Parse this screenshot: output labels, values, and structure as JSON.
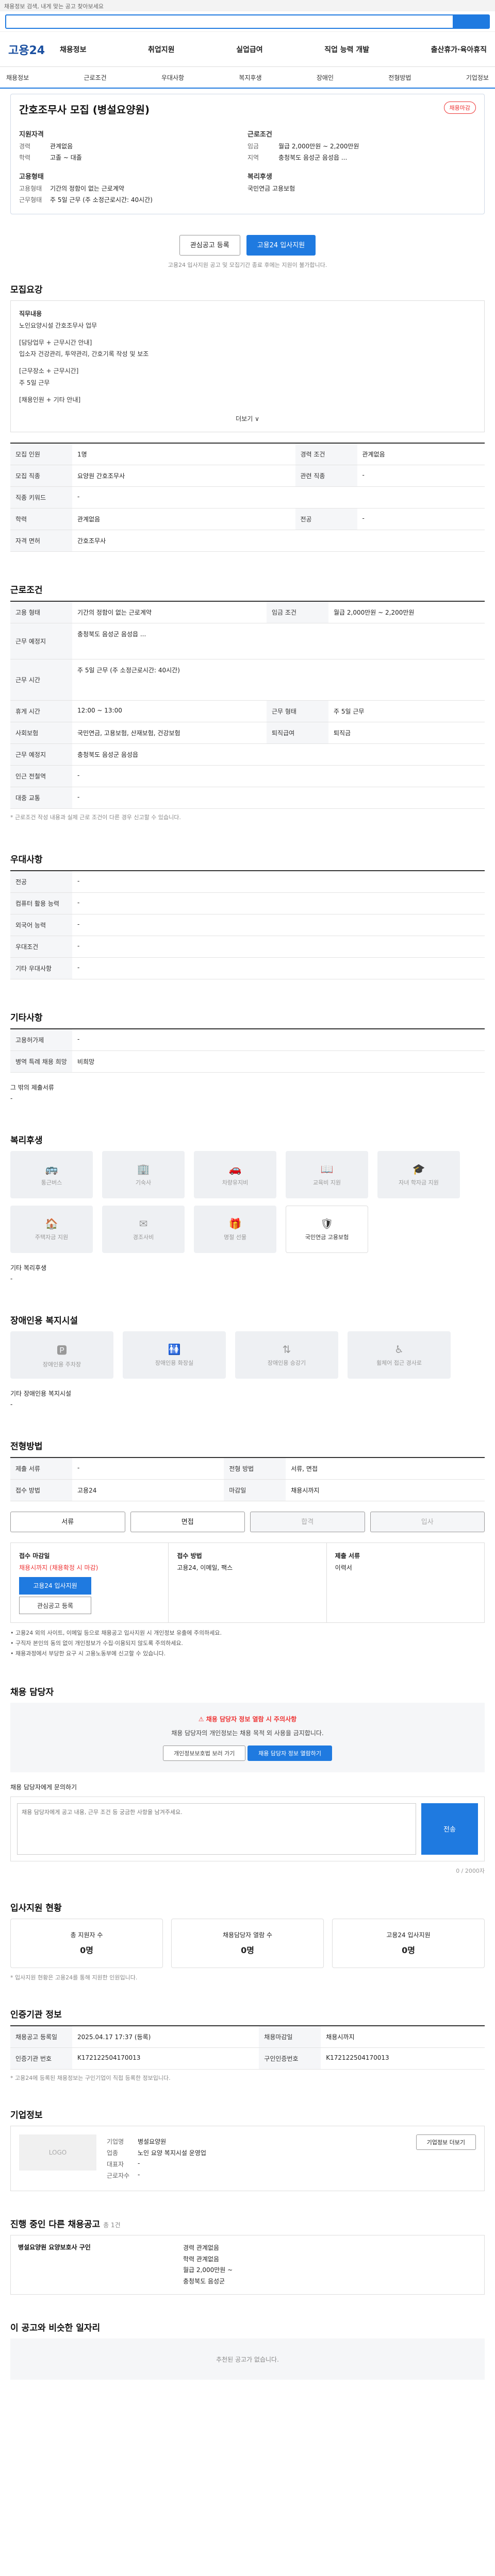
{
  "header": {
    "note": "채용정보 검색, 내게 맞는 공고 찾아보세요",
    "logo": "고용24",
    "menu": [
      "채용정보",
      "취업지원",
      "실업급여",
      "직업 능력 개발",
      "출산휴가·육아휴직"
    ],
    "subnav": [
      "채용정보",
      "근로조건",
      "우대사항",
      "복지후생",
      "장애인",
      "전형방법",
      "기업정보"
    ]
  },
  "job": {
    "title": "간호조무사 모집 (병설요양원)",
    "badge": "채용마감",
    "left_title": "지원자격",
    "right_title": "근로조건",
    "left_rows": [
      {
        "k": "경력",
        "v": "관계없음"
      },
      {
        "k": "학력",
        "v": "고졸 ~ 대졸"
      }
    ],
    "right_rows": [
      {
        "k": "임금",
        "v": "월급 2,000만원 ~ 2,200만원"
      },
      {
        "k": "지역",
        "v": "충청북도 음성군 음성읍 ..."
      }
    ],
    "left_rows2_title": "고용형태",
    "left_rows2": [
      {
        "k": "고용형태",
        "v": "기간의 정함이 없는 근로계약"
      },
      {
        "k": "근무형태",
        "v": "주 5일 근무 (주 소정근로시간: 40시간)"
      }
    ],
    "right_rows2_title": "복리후생",
    "right_rows2": [
      {
        "k": "",
        "v": "국민연금 고용보험"
      }
    ],
    "btn_save": "관심공고 등록",
    "btn_apply": "고용24 입사지원",
    "apply_note": "고용24 입사지원 공고 및 모집기간 종료 후에는 지원이 불가합니다."
  },
  "sections": {
    "recruit": "모집요강",
    "cond": "근로조건",
    "pref": "우대사항",
    "other": "기타사항",
    "welfare": "복리후생",
    "disabled": "장애인용 복지시설",
    "process": "전형방법",
    "manager": "채용 담당자",
    "history": "입사지원 현황",
    "info": "인증기관 정보",
    "company": "기업정보",
    "similar": "진행 중인 다른 채용공고",
    "ai": "이 공고와 비슷한 일자리"
  },
  "recruit": {
    "label": "직무내용",
    "lines": [
      "노인요양시설 간호조무사 업무",
      "[담당업무 + 근무시간 안내]",
      "입소자 건강관리, 투약관리, 간호기록 작성 및 보조",
      "[근무장소 + 근무시간]",
      "주 5일 근무",
      "[채용인원 + 기타 안내]"
    ],
    "more": "더보기 ∨",
    "table": [
      {
        "k": "모집 인원",
        "v": "1명",
        "k2": "경력 조건",
        "v2": "관계없음"
      },
      {
        "k": "모집 직종",
        "v": "요양원 간호조무사",
        "k2": "관련 직종",
        "v2": "-"
      },
      {
        "k": "직종 키워드",
        "v": "-",
        "k2": "",
        "v2": ""
      },
      {
        "k": "학력",
        "v": "관계없음",
        "k2": "전공",
        "v2": "-"
      },
      {
        "k": "자격 면허",
        "v": "간호조무사",
        "k2": "",
        "v2": ""
      }
    ]
  },
  "cond": {
    "rows": [
      {
        "k": "고용 형태",
        "v": "기간의 정함이 없는 근로계약",
        "k2": "임금 조건",
        "v2": "월급 2,000만원 ~ 2,200만원"
      },
      {
        "k": "근무 예정지",
        "v": "충청북도 음성군 음성읍 ...",
        "k2": "",
        "v2": ""
      },
      {
        "k": "근무 시간",
        "v": "주 5일 근무 (주 소정근로시간: 40시간)",
        "k2": "",
        "v2": ""
      },
      {
        "k": "휴게 시간",
        "v": "12:00 ~ 13:00",
        "k2": "근무 형태",
        "v2": "주 5일 근무"
      },
      {
        "k": "사회보험",
        "v": "국민연금, 고용보험, 산재보험, 건강보험",
        "k2": "퇴직급여",
        "v2": "퇴직금"
      },
      {
        "k": "근무 예정지",
        "v": "충청북도 음성군 음성읍",
        "k2": "",
        "v2": ""
      },
      {
        "k": "인근 전철역",
        "v": "-",
        "k2": "",
        "v2": ""
      },
      {
        "k": "대중 교통",
        "v": "-",
        "k2": "",
        "v2": ""
      }
    ],
    "note": "* 근로조건 작성 내용과 실제 근로 조건이 다른 경우 신고할 수 있습니다."
  },
  "pref": {
    "rows": [
      {
        "k": "전공",
        "v": "-"
      },
      {
        "k": "컴퓨터 활용 능력",
        "v": "-"
      },
      {
        "k": "외국어 능력",
        "v": "-"
      },
      {
        "k": "우대조건",
        "v": "-"
      },
      {
        "k": "기타 우대사항",
        "v": "-"
      }
    ]
  },
  "other": {
    "rows": [
      {
        "k": "고용허가제",
        "v": "-"
      },
      {
        "k": "병역 특례 채용 희망",
        "v": "비희망"
      }
    ],
    "extra_label": "그 밖의 제출서류",
    "extra_value": "-"
  },
  "welfare": {
    "items": [
      "통근버스",
      "기숙사",
      "차량유지비",
      "교육비 지원",
      "자녀 학자금 지원",
      "주택자금 지원",
      "경조사비",
      "명절 선물",
      "국민연금 고용보험"
    ],
    "extra_label": "기타 복리후생",
    "extra_value": "-"
  },
  "disabled": {
    "items": [
      "장애인용 주차장",
      "장애인용 화장실",
      "장애인용 승강기",
      "휠체어 접근 경사로"
    ],
    "extra_label": "기타 장애인용 복지시설",
    "extra_value": "-"
  },
  "process": {
    "rows": [
      {
        "k": "제출 서류",
        "v": "-"
      },
      {
        "k": "전형 방법",
        "v": "서류, 면접"
      },
      {
        "k": "접수 방법",
        "v": "고용24"
      },
      {
        "k": "마감일",
        "v": "채용시까지"
      }
    ],
    "steps": [
      "서류",
      "면접",
      "합격",
      "입사"
    ]
  },
  "apply": {
    "c1_title": "접수 마감일",
    "c1_value": "채용시까지 (채용확정 시 마감)",
    "c1_btn": "고용24 입사지원",
    "c1_btn2": "관심공고 등록",
    "c2_title": "접수 방법",
    "c2_value": "고용24, 이메일, 팩스",
    "c3_title": "제출 서류",
    "c3_value": "이력서"
  },
  "warn": [
    "• 고용24 외의 사이트, 이메일 등으로 채용공고 입사지원 시 개인정보 유출에 주의하세요.",
    "• 구직자 본인의 동의 없이 개인정보가 수집·이용되지 않도록 주의하세요.",
    "• 채용과정에서 부당한 요구 시 고용노동부에 신고할 수 있습니다."
  ],
  "manager": {
    "alert": "채용 담당자 정보 열람 시 주의사항",
    "desc": "채용 담당자의 개인정보는 채용 목적 외 사용을 금지합니다.",
    "btn1": "개인정보보호법 보러 가기",
    "btn2": "채용 담당자 정보 열람하기",
    "q_label": "채용 담당자에게 문의하기",
    "q_placeholder": "채용 담당자에게 공고 내용, 근무 조건 등 궁금한 사항을 남겨주세요.",
    "q_send": "전송",
    "q_count": "0 / 2000자"
  },
  "history": {
    "stats": [
      {
        "label": "총 지원자 수",
        "value": "0명"
      },
      {
        "label": "채용담당자 열람 수",
        "value": "0명"
      },
      {
        "label": "고용24 입사지원",
        "value": "0명"
      }
    ],
    "note": "* 입사지원 현황은 고용24를 통해 지원한 인원입니다."
  },
  "info": {
    "rows": [
      {
        "k": "채용공고 등록일",
        "v": "2025.04.17 17:37 (등록)",
        "k2": "채용마감일",
        "v2": "채용시까지"
      },
      {
        "k": "인증기관 번호",
        "v": "K172122504170013",
        "k2": "구인인증번호",
        "v2": "K172122504170013"
      }
    ],
    "note": "* 고용24에 등록된 채용정보는 구인기업이 직접 등록한 정보입니다."
  },
  "company": {
    "logo": "LOGO",
    "rows": [
      {
        "k": "기업명",
        "v": "병설요양원"
      },
      {
        "k": "업종",
        "v": "노인 요양 복지시설 운영업"
      },
      {
        "k": "대표자",
        "v": "-"
      },
      {
        "k": "근로자수",
        "v": "-"
      }
    ],
    "btn": "기업정보 더보기"
  },
  "similar": {
    "name": "병설요양원 요양보호사 구인",
    "rows": [
      "경력 관계없음",
      "학력 관계없음",
      "월급 2,000만원 ~",
      "충청북도 음성군"
    ],
    "count": "총 1건"
  },
  "ai": {
    "empty": "추천된 공고가 없습니다."
  },
  "colors": {
    "accent": "#1f7ae0",
    "danger": "#e33333"
  }
}
